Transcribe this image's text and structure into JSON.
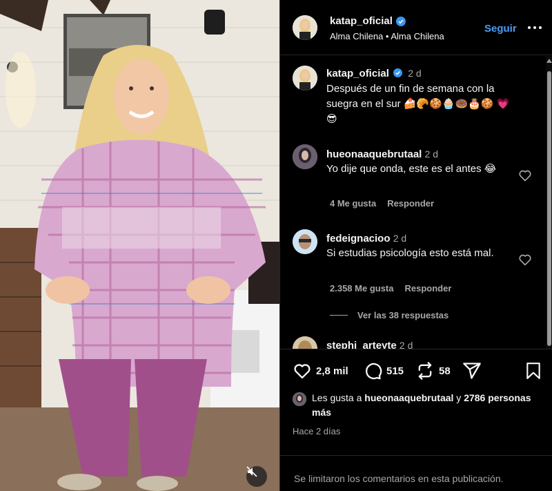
{
  "post": {
    "author": "katap_oficial",
    "location": "Alma Chilena • Alma Chilena",
    "follow_label": "Seguir"
  },
  "caption": {
    "username": "katap_oficial",
    "time": "2 d",
    "text": "Después de un fin de semana con la suegra en el sur 🍰🥐🍪🧁🍩🎂🍪 💗 😎"
  },
  "comments": [
    {
      "username": "hueonaaquebrutaal",
      "time": "2 d",
      "text": "Yo dije que onda, este es el antes 😂",
      "likes": "4 Me gusta",
      "reply": "Responder"
    },
    {
      "username": "fedeignacioo",
      "time": "2 d",
      "text": "Si estudias psicología esto está mal.",
      "likes": "2.358 Me gusta",
      "reply": "Responder",
      "view_replies": "Ver las 38 respuestas"
    },
    {
      "username": "stephi_arteyte",
      "time": "2 d"
    }
  ],
  "actions": {
    "likes_count": "2,8 mil",
    "comments_count": "515",
    "reposts_count": "58"
  },
  "liked_by": {
    "prefix": "Les gusta a ",
    "user": "hueonaaquebrutaal",
    "middle": " y ",
    "others": "2786 personas más"
  },
  "posted_ago": "Hace 2 días",
  "footer_notice": "Se limitaron los comentarios en esta publicación.",
  "colors": {
    "accent": "#4a9df8",
    "background": "#000000",
    "muted": "#a8a8a8",
    "verified": "#3897f0"
  },
  "icons": [
    "verified-badge-icon",
    "more-options-icon",
    "heart-icon",
    "comment-icon",
    "repost-icon",
    "share-icon",
    "bookmark-icon",
    "mute-icon"
  ]
}
